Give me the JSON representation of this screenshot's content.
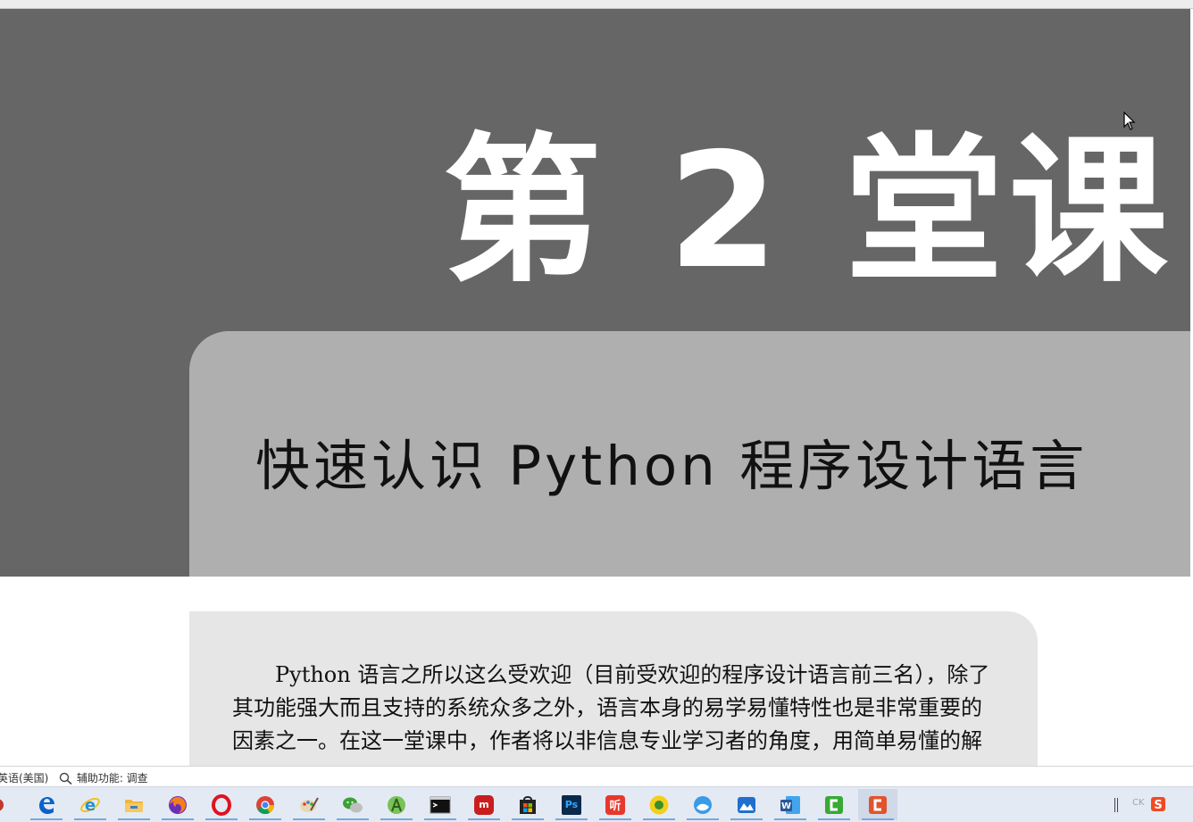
{
  "document": {
    "chapter_title": "第 2 堂课",
    "subtitle": "快速认识 Python 程序设计语言",
    "body_lines": [
      "Python 语言之所以这么受欢迎（目前受欢迎的程序设计语言前三名），除了",
      "其功能强大而且支持的系统众多之外，语言本身的易学易懂特性也是非常重要的",
      "因素之一。在这一堂课中，作者将以非信息专业学习者的角度，用简单易懂的解"
    ]
  },
  "status_bar": {
    "language": "英语(美国)",
    "accessibility": "辅助功能: 调查"
  },
  "taskbar": {
    "apps": [
      {
        "name": "Edge",
        "icon": "edge-icon",
        "color": "#0a63c9"
      },
      {
        "name": "Internet Explorer",
        "icon": "internet-explorer-icon",
        "color": "#2a8fd8"
      },
      {
        "name": "File Explorer",
        "icon": "folder-icon",
        "color": "#f2b53b"
      },
      {
        "name": "Firefox",
        "icon": "firefox-icon",
        "color": "#e66000"
      },
      {
        "name": "Opera",
        "icon": "opera-icon",
        "color": "#e0131e"
      },
      {
        "name": "Chrome",
        "icon": "chrome-icon",
        "color": "#3aa757"
      },
      {
        "name": "Paint",
        "icon": "paint-icon",
        "color": "#6aa6dc"
      },
      {
        "name": "WeChat",
        "icon": "wechat-icon",
        "color": "#3aa236"
      },
      {
        "name": "Android Studio",
        "icon": "android-studio-icon",
        "color": "#78c257"
      },
      {
        "name": "Command Prompt",
        "icon": "terminal-icon",
        "color": "#111111"
      },
      {
        "name": "Red App",
        "icon": "red-app-icon",
        "color": "#c81e1e"
      },
      {
        "name": "Microsoft Store",
        "icon": "store-icon",
        "color": "#222222"
      },
      {
        "name": "Photoshop",
        "icon": "photoshop-icon",
        "color": "#0b2a4a"
      },
      {
        "name": "Listen App",
        "icon": "listen-app-icon",
        "color": "#e8372c"
      },
      {
        "name": "Yellow App",
        "icon": "yellow-app-icon",
        "color": "#f4cf1a"
      },
      {
        "name": "Browser",
        "icon": "browser-icon",
        "color": "#3b9be8"
      },
      {
        "name": "Photos",
        "icon": "photos-icon",
        "color": "#1f6fd1"
      },
      {
        "name": "Word",
        "icon": "word-icon",
        "color": "#2b579a"
      },
      {
        "name": "Camtasia Green",
        "icon": "camtasia-green-icon",
        "color": "#39a935"
      },
      {
        "name": "Camtasia Orange",
        "icon": "camtasia-orange-icon",
        "color": "#e2532c"
      }
    ],
    "tray": {
      "ime": "CK",
      "sogou_icon": "sogou-icon"
    }
  }
}
